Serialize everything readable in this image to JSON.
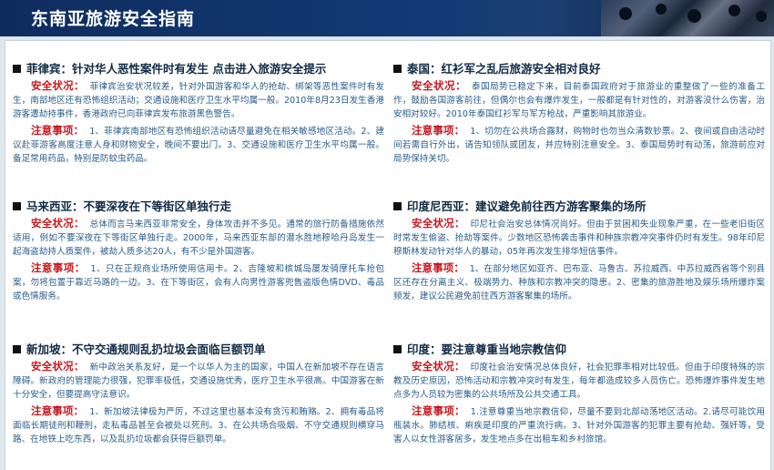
{
  "header": {
    "title": "东南亚旅游安全指南"
  },
  "sections": [
    {
      "title": "菲律宾：针对华人恶性案件时有发生 点击进入旅游安全提示",
      "safety_label": "安全状况：",
      "safety": "菲律宾治安状况较差，针对外国游客和华人的抢劫、绑架等恶性案件时有发生，南部地区还有恐怖组织活动；交通设施和医疗卫生水平均属一般。2010年8月23日发生香港游客遭劫持事件，香港政府已向菲律宾发布旅游黑色警告。",
      "notes_label": "注意事项：",
      "notes": "1、菲律宾南部地区有恐怖组织活动请尽量避免在相关敏感地区活动。2、建议赴菲游客高度注意人身和财物安全，晚间不要出门。3、交通设施和医疗卫生水平均属一般。备足常用药品，特别是防蚊虫药品。"
    },
    {
      "title": "泰国：红衫军之乱后旅游安全相对良好",
      "safety_label": "安全状况：",
      "safety": "泰国局势已稳定下来，目前泰国政府对于旅游业的重整做了一些的准备工作，鼓励各国游客前往，但偶尔也会有爆炸发生，一般都是有针对性的，对游客没什么伤害，治安相对较好。2010年泰国红衫军与军方枪战，严重影响其旅游业。",
      "notes_label": "注意事项：",
      "notes": "1、切勿在公共场合露财，购物时也勿当众清数钞票。2、夜间或自由活动时间若需自行外出，请告知领队或团友，并应特别注意安全。3、泰国局势时有动荡，旅游前应对局势保持关切。"
    },
    {
      "title": "马来西亚：不要深夜在下等街区单独行走",
      "safety_label": "安全状况：",
      "safety": "总体而言马来西亚非常安全，身体攻击并不多见。通常的旅行防备措施依然适用，例如不要深夜在下等街区单独行走。2000年，马来西亚东部的潜水胜地穆哈丹岛发生一起海盗劫持人质案件，被劫人质多达20人，有不少是外国游客。",
      "notes_label": "注意事项：",
      "notes": "1、只在正规商业场所使用信用卡。2、吉隆坡和槟城岛屡发骑摩托车抢包案，勿将包置于靠近马路的一边。3、在下等街区，会有人向男性游客兜售盗版色情DVD、毒品或色情服务。"
    },
    {
      "title": "印度尼西亚：建议避免前往西方游客聚集的场所",
      "safety_label": "安全状况：",
      "safety": "印尼社会治安总体情况尚好。但由于贫困和失业现象严重，在一些老旧街区时常发生偷盗、抢劫等案件。少数地区恐怖袭击事件和种族宗教冲突事件仍时有发生。98年印尼穆斯林发动针对华人的暴动，05年再次发生排华短信事件。",
      "notes_label": "注意事项：",
      "notes": "1、在部分地区如亚齐、巴布亚、马鲁古、苏拉威西、中苏拉威西省等个别县区还存在分离主义、极端势力、种族和宗教冲突的隐患。2、密集的旅游胜地及娱乐场所爆炸案频发，建议公民避免前往西方游客聚集的场所。"
    },
    {
      "title": "新加坡：不守交通规则乱扔垃圾会面临巨额罚单",
      "safety_label": "安全状况：",
      "safety": "新中政治关系友好，是一个以华人为主的国家，中国人在新加坡不存在语言障碍。新政府的管理能力很强，犯罪率极低，交通设施优秀，医疗卫生水平很高。中国游客在新十分安全，但要提高守法意识。",
      "notes_label": "注意事项：",
      "notes": "1、新加坡法律极为严厉，不过这里也基本没有贪污和贿赂。2、拥有毒品将面临长期徒刑和鞭刑，走私毒品甚至会被处以死刑。3、在公共场合吸烟、不守交通规则横穿马路、在地铁上吃东西，以及乱扔垃圾都会获得巨额罚单。"
    },
    {
      "title": "印度：要注意尊重当地宗教信仰",
      "safety_label": "安全状况：",
      "safety": "印度社会治安情况总体良好，社会犯罪率相对比较低。但由于印度特殊的宗教及历史原因，恐怖活动和宗教冲突时有发生，每年都造成较多人员伤亡。恐怖爆炸事件发生地点多为人员较为密集的公共场所及公共交通工具。",
      "notes_label": "注意事项：",
      "notes": "1.注意尊重当地宗教信仰，尽量不要到北部动荡地区活动。2.请尽可能饮用瓶装水。肺结核、痢疾是印度的严重流行病。3、针对外国游客的犯罪主要有抢劫、强奸等，受害人以女性游客居多，发生地点多在出租车和乡村旅馆。"
    }
  ]
}
